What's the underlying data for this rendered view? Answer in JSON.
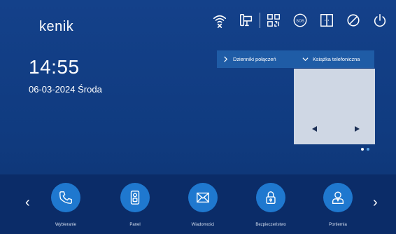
{
  "brand": {
    "logo_text": "kenik"
  },
  "status_icons": [
    "wifi-off-icon",
    "door-bell-icon",
    "qr-code-icon",
    "sos-icon",
    "split-door-icon",
    "do-not-disturb-icon",
    "power-icon"
  ],
  "clock": {
    "time": "14:55",
    "date": "06-03-2024 Środa"
  },
  "panel": {
    "tab_call_log": "Dzienniki połączeń",
    "tab_phonebook": "Książka telefoniczna",
    "preview_left_arrow": "◀",
    "preview_right_arrow": "▶",
    "pager": {
      "count": 2,
      "active_index": 0
    }
  },
  "dock": {
    "prev": "‹",
    "next": "›",
    "apps": [
      {
        "label": "Wybieranie",
        "icon": "phone-icon"
      },
      {
        "label": "Panel",
        "icon": "intercom-panel-icon"
      },
      {
        "label": "Wiadomości",
        "icon": "envelope-icon"
      },
      {
        "label": "Bezpieczeństwo",
        "icon": "padlock-icon"
      },
      {
        "label": "Portiernia",
        "icon": "concierge-icon"
      }
    ]
  },
  "colors": {
    "background": "#123f86",
    "dock": "#0b2c68",
    "accent": "#1f78cf",
    "tab_bar": "#1f5ca6",
    "preview": "#cfd7e4"
  }
}
